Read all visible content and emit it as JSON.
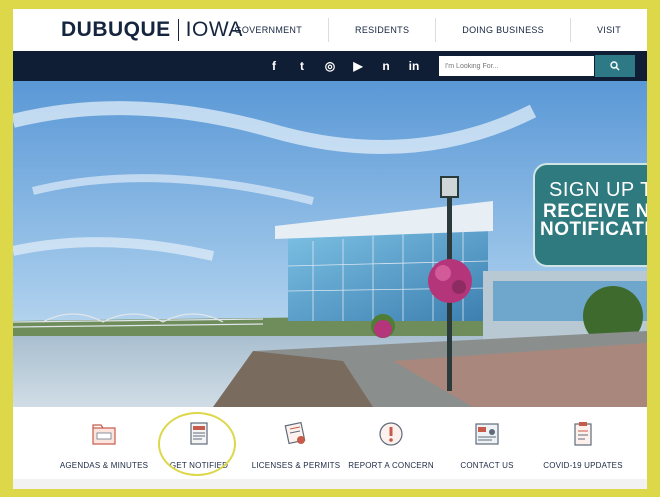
{
  "logo": {
    "part1": "DUBUQUE",
    "part2": "IOWA"
  },
  "nav": [
    {
      "label": "GOVERNMENT"
    },
    {
      "label": "RESIDENTS"
    },
    {
      "label": "DOING BUSINESS"
    },
    {
      "label": "VISIT"
    }
  ],
  "social": [
    {
      "icon": "facebook-icon",
      "glyph": "f"
    },
    {
      "icon": "twitter-icon",
      "glyph": "t"
    },
    {
      "icon": "instagram-icon",
      "glyph": "◎"
    },
    {
      "icon": "youtube-icon",
      "glyph": "▶"
    },
    {
      "icon": "nextdoor-icon",
      "glyph": "n"
    },
    {
      "icon": "linkedin-icon",
      "glyph": "in"
    }
  ],
  "search": {
    "placeholder": "I'm Looking For...",
    "icon": "search-icon"
  },
  "signup": {
    "line1": "SIGN UP T",
    "line2": "RECEIVE NE",
    "line3": "NOTIFICATIO"
  },
  "quick_links": [
    {
      "label": "AGENDAS & MINUTES",
      "icon": "folder-icon"
    },
    {
      "label": "GET NOTIFIED",
      "icon": "newspaper-icon"
    },
    {
      "label": "LICENSES & PERMITS",
      "icon": "certificate-icon"
    },
    {
      "label": "REPORT A CONCERN",
      "icon": "alert-icon"
    },
    {
      "label": "CONTACT US",
      "icon": "contact-icon"
    },
    {
      "label": "COVID-19 UPDATES",
      "icon": "clipboard-icon"
    }
  ],
  "colors": {
    "navy": "#0f1d35",
    "teal": "#2e7a7f",
    "highlight": "#dcd84a"
  }
}
